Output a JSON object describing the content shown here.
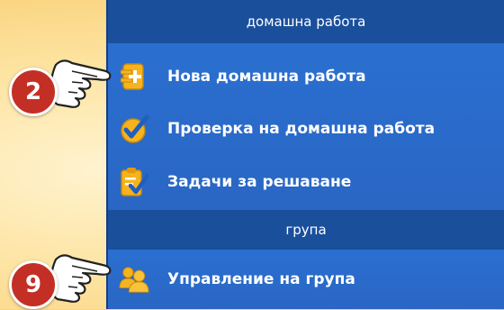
{
  "sections": [
    {
      "title": "домашна работа"
    },
    {
      "title": "група"
    }
  ],
  "items": [
    {
      "label": "Нова домашна работа",
      "icon": "new-homework-icon"
    },
    {
      "label": "Проверка на домашна работа",
      "icon": "checkmark-icon"
    },
    {
      "label": "Задачи за решаване",
      "icon": "tasks-icon"
    },
    {
      "label": "Управление на група",
      "icon": "group-users-icon"
    }
  ],
  "callouts": [
    {
      "number": "2"
    },
    {
      "number": "9"
    }
  ],
  "colors": {
    "panel": "#1a53a8",
    "header": "#1a4f9c",
    "item_bg": "#2a6fd0",
    "callout": "#c42f25",
    "background": "#fde3a0"
  }
}
